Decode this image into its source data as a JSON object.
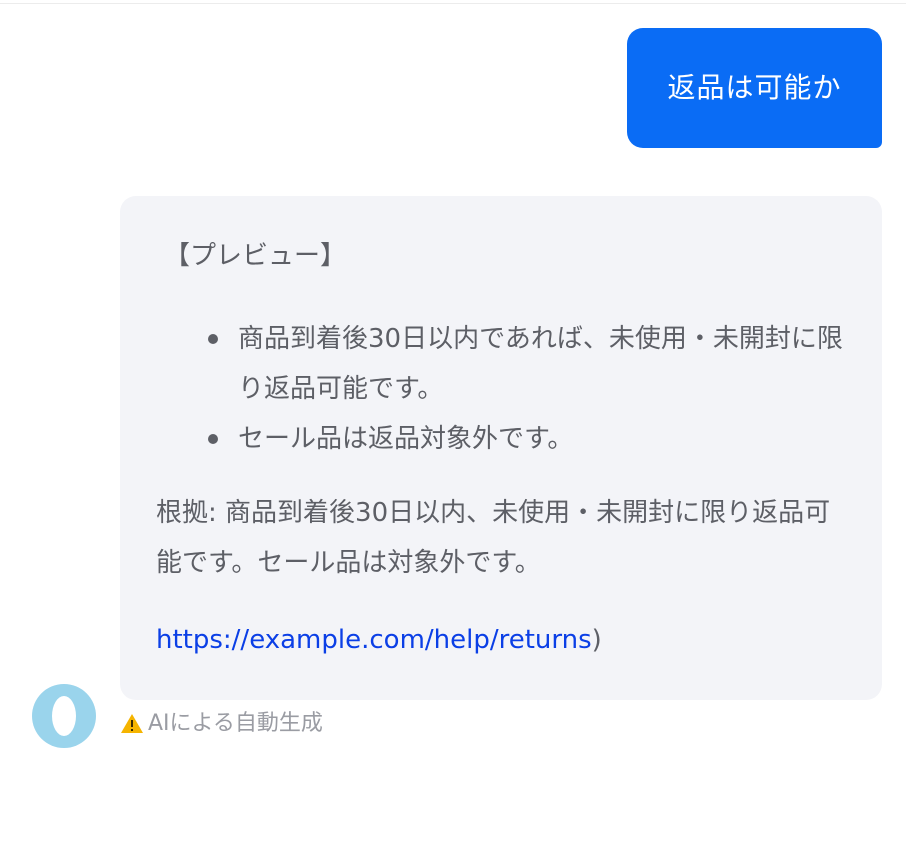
{
  "user_message": {
    "text": "返品は可能か",
    "color": "#0a6cf5"
  },
  "bot_message": {
    "heading": "【プレビュー】",
    "bullets": [
      "商品到着後30日以内であれば、未使用・未開封に限り返品可能です。",
      "セール品は返品対象外です。"
    ],
    "basis": "根拠: 商品到着後30日以内、未使用・未開封に限り返品可能です。セール品は対象外です。",
    "link": "https://example.com/help/returns",
    "link_suffix": ")",
    "link_color": "#0b3fe6"
  },
  "avatar": {
    "icon": "bot-avatar-icon",
    "color": "#9ad4ec"
  },
  "footer": {
    "warning_icon": "warning-icon",
    "ai_notice": "AIによる自動生成"
  }
}
